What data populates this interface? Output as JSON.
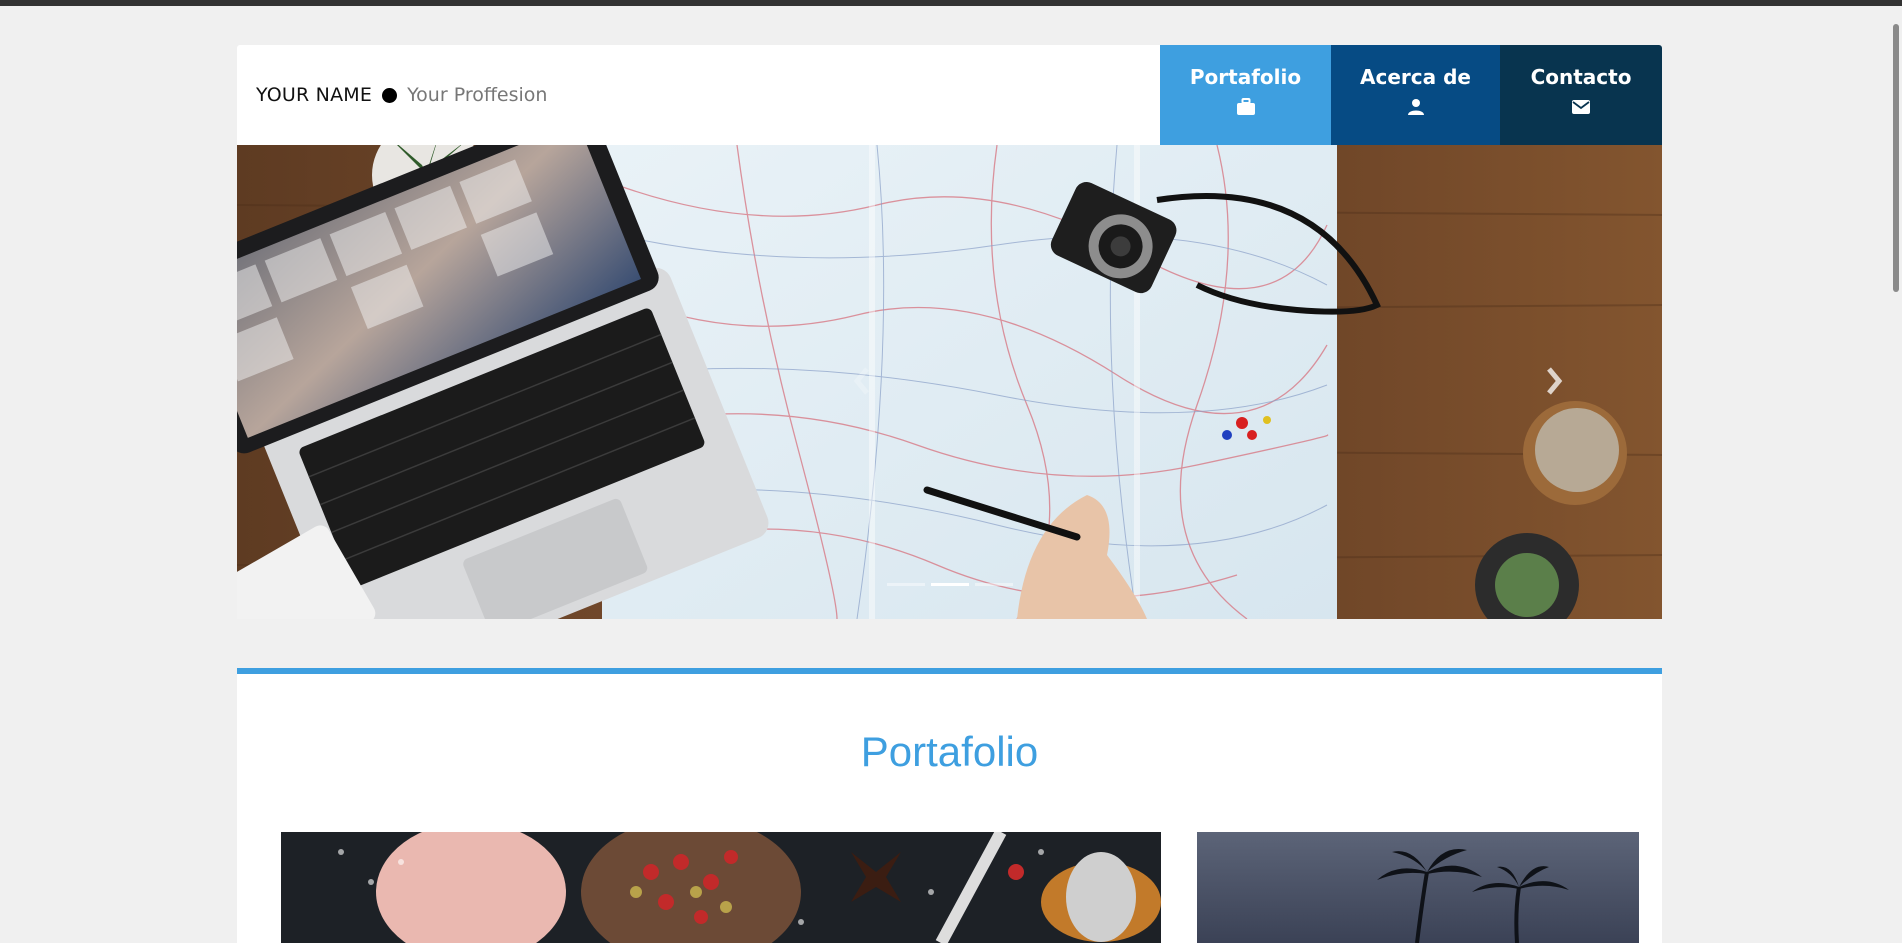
{
  "header": {
    "name": "YOUR NAME",
    "profession": "Your Proffesion"
  },
  "nav": [
    {
      "label": "Portafolio",
      "icon": "briefcase-icon"
    },
    {
      "label": "Acerca de",
      "icon": "person-icon"
    },
    {
      "label": "Contacto",
      "icon": "mail-icon"
    }
  ],
  "carousel": {
    "slide_count": 3,
    "active_index": 1
  },
  "portfolio": {
    "title": "Portafolio"
  },
  "colors": {
    "accent": "#3e9fe0",
    "nav_acerca": "#064b84",
    "nav_contacto": "#08344f",
    "background": "#f0f0f0"
  }
}
